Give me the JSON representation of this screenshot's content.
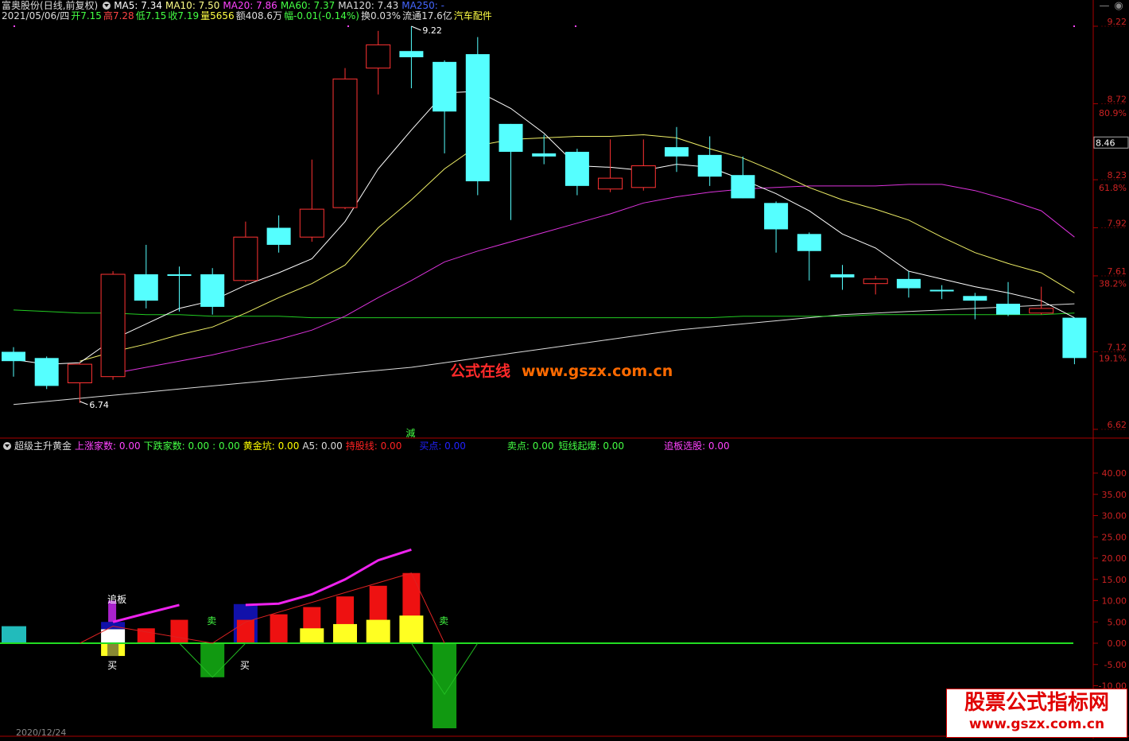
{
  "header": {
    "stock_name": "富奥股份",
    "period": "(日线,前复权)",
    "ma": [
      {
        "label": "MA5: 7.34",
        "color": "#ffffff"
      },
      {
        "label": "MA10: 7.50",
        "color": "#ffff88"
      },
      {
        "label": "MA20: 7.86",
        "color": "#ff44ff"
      },
      {
        "label": "MA60: 7.37",
        "color": "#44ff44"
      },
      {
        "label": "MA120: 7.43",
        "color": "#dddddd"
      },
      {
        "label": "MA250: -",
        "color": "#4466ff"
      }
    ]
  },
  "quote": {
    "date": "2021/05/06/四",
    "open": "开7.15",
    "high": "高7.28",
    "low": "低7.15",
    "close": "收7.19",
    "volume": "量5656",
    "amount": "额408.6万",
    "change": "幅-0.01(-0.14%)",
    "turnover": "换0.03%",
    "float": "流通17.6亿",
    "industry": "汽车配件"
  },
  "price_axis": {
    "ticks": [
      {
        "label": "9.22",
        "value": 9.22
      },
      {
        "label": "8.72",
        "value": 8.72
      },
      {
        "label": "8.23",
        "value": 8.23
      },
      {
        "label": "7.92",
        "value": 7.92
      },
      {
        "label": "7.61",
        "value": 7.61
      },
      {
        "label": "7.12",
        "value": 7.12
      },
      {
        "label": "6.62",
        "value": 6.62
      }
    ],
    "pct_ticks": [
      {
        "label": "80.9%",
        "value": 8.66
      },
      {
        "label": "61.8%",
        "value": 8.18
      },
      {
        "label": "38.2%",
        "value": 7.56
      },
      {
        "label": "19.1%",
        "value": 7.08
      }
    ],
    "current": "8.46",
    "max_label": "9.22",
    "min_label": "6.74"
  },
  "mark_text": "減",
  "indicator": {
    "name": "超级主升黄金",
    "fields": [
      {
        "label": "上涨家数: 0.00",
        "color": "#ff44ff"
      },
      {
        "label": "下跌家数: 0.00",
        "color": "#44ff44"
      },
      {
        "label": ": 0.00",
        "color": "#44ff44"
      },
      {
        "label": "黄金坑: 0.00",
        "color": "#ffff00"
      },
      {
        "label": "A5: 0.00",
        "color": "#dddddd"
      },
      {
        "label": "持股线: 0.00",
        "color": "#ff2222"
      },
      {
        "label": "买点: 0.00",
        "color": "#2222ff"
      },
      {
        "label": "卖点: 0.00",
        "color": "#44ff44"
      },
      {
        "label": "短线起爆: 0.00",
        "color": "#44ff44"
      },
      {
        "label": "追板选股: 0.00",
        "color": "#ff44ff"
      }
    ],
    "ticks": [
      {
        "label": "40.00",
        "value": 40
      },
      {
        "label": "35.00",
        "value": 35
      },
      {
        "label": "30.00",
        "value": 30
      },
      {
        "label": "25.00",
        "value": 25
      },
      {
        "label": "20.00",
        "value": 20
      },
      {
        "label": "15.00",
        "value": 15
      },
      {
        "label": "10.00",
        "value": 10
      },
      {
        "label": "5.00",
        "value": 5
      },
      {
        "label": "0.00",
        "value": 0
      },
      {
        "label": "-5.00",
        "value": -5
      },
      {
        "label": "-10.00",
        "value": -10
      }
    ],
    "labels": [
      {
        "text": "追板",
        "i": 3,
        "v": 9.5,
        "color": "#ffffff"
      },
      {
        "text": "卖",
        "i": 6,
        "v": 4.5,
        "color": "#44ff44"
      },
      {
        "text": "卖",
        "i": 13,
        "v": 4.5,
        "color": "#44ff44"
      },
      {
        "text": "买",
        "i": 3,
        "v": -6,
        "color": "#ffffff"
      },
      {
        "text": "买",
        "i": 7,
        "v": -6,
        "color": "#ffffff"
      }
    ]
  },
  "watermark": {
    "cn": "公式在线",
    "url": "www.gszx.com.cn"
  },
  "logo": {
    "line1": "股票公式指标网",
    "line2": "www.gszx.com.cn"
  },
  "bottom_date": "2020/12/24",
  "chart_data": {
    "type": "candlestick",
    "candles": [
      {
        "o": 7.12,
        "c": 7.06,
        "h": 7.15,
        "l": 6.96
      },
      {
        "o": 7.08,
        "c": 6.9,
        "h": 7.09,
        "l": 6.88
      },
      {
        "o": 6.92,
        "c": 7.04,
        "h": 7.05,
        "l": 6.79
      },
      {
        "o": 6.96,
        "c": 7.62,
        "h": 7.64,
        "l": 6.94
      },
      {
        "o": 7.62,
        "c": 7.45,
        "h": 7.81,
        "l": 7.4
      },
      {
        "o": 7.62,
        "c": 7.61,
        "h": 7.67,
        "l": 7.38
      },
      {
        "o": 7.62,
        "c": 7.41,
        "h": 7.66,
        "l": 7.36
      },
      {
        "o": 7.58,
        "c": 7.86,
        "h": 7.96,
        "l": 7.57
      },
      {
        "o": 7.92,
        "c": 7.81,
        "h": 8.0,
        "l": 7.76
      },
      {
        "o": 7.86,
        "c": 8.04,
        "h": 8.36,
        "l": 7.83
      },
      {
        "o": 8.05,
        "c": 8.88,
        "h": 8.95,
        "l": 8.04
      },
      {
        "o": 8.95,
        "c": 9.1,
        "h": 9.19,
        "l": 8.78
      },
      {
        "o": 9.06,
        "c": 9.02,
        "h": 9.22,
        "l": 8.82
      },
      {
        "o": 8.99,
        "c": 8.67,
        "h": 9.0,
        "l": 8.4
      },
      {
        "o": 9.04,
        "c": 8.22,
        "h": 9.15,
        "l": 8.13
      },
      {
        "o": 8.59,
        "c": 8.41,
        "h": 8.59,
        "l": 7.97
      },
      {
        "o": 8.4,
        "c": 8.38,
        "h": 8.52,
        "l": 8.33
      },
      {
        "o": 8.41,
        "c": 8.19,
        "h": 8.43,
        "l": 8.13
      },
      {
        "o": 8.17,
        "c": 8.24,
        "h": 8.49,
        "l": 8.15
      },
      {
        "o": 8.18,
        "c": 8.32,
        "h": 8.49,
        "l": 8.16
      },
      {
        "o": 8.44,
        "c": 8.38,
        "h": 8.57,
        "l": 8.28
      },
      {
        "o": 8.39,
        "c": 8.25,
        "h": 8.51,
        "l": 8.19
      },
      {
        "o": 8.26,
        "c": 8.11,
        "h": 8.38,
        "l": 8.11
      },
      {
        "o": 8.08,
        "c": 7.91,
        "h": 8.09,
        "l": 7.76
      },
      {
        "o": 7.88,
        "c": 7.77,
        "h": 7.89,
        "l": 7.58
      },
      {
        "o": 7.62,
        "c": 7.6,
        "h": 7.68,
        "l": 7.52
      },
      {
        "o": 7.56,
        "c": 7.59,
        "h": 7.61,
        "l": 7.49
      },
      {
        "o": 7.59,
        "c": 7.53,
        "h": 7.64,
        "l": 7.47
      },
      {
        "o": 7.52,
        "c": 7.51,
        "h": 7.55,
        "l": 7.46
      },
      {
        "o": 7.48,
        "c": 7.45,
        "h": 7.5,
        "l": 7.33
      },
      {
        "o": 7.43,
        "c": 7.36,
        "h": 7.57,
        "l": 7.35
      },
      {
        "o": 7.37,
        "c": 7.4,
        "h": 7.54,
        "l": 7.36
      },
      {
        "o": 7.34,
        "c": 7.08,
        "h": 7.34,
        "l": 7.04
      }
    ],
    "ma5": [
      7.07,
      7.04,
      7.05,
      7.2,
      7.3,
      7.4,
      7.45,
      7.55,
      7.63,
      7.72,
      7.96,
      8.3,
      8.55,
      8.79,
      8.8,
      8.69,
      8.53,
      8.32,
      8.31,
      8.29,
      8.33,
      8.31,
      8.23,
      8.14,
      8.03,
      7.88,
      7.79,
      7.64,
      7.59,
      7.54,
      7.5,
      7.45,
      7.34
    ],
    "ma10": [
      null,
      null,
      7.06,
      7.12,
      7.17,
      7.23,
      7.28,
      7.37,
      7.47,
      7.56,
      7.68,
      7.92,
      8.1,
      8.3,
      8.45,
      8.49,
      8.5,
      8.51,
      8.51,
      8.52,
      8.5,
      8.43,
      8.37,
      8.28,
      8.18,
      8.1,
      8.04,
      7.97,
      7.86,
      7.76,
      7.69,
      7.63,
      7.5
    ],
    "ma20": [
      null,
      null,
      null,
      6.98,
      7.02,
      7.06,
      7.1,
      7.15,
      7.2,
      7.26,
      7.35,
      7.47,
      7.58,
      7.7,
      7.77,
      7.83,
      7.89,
      7.95,
      8.01,
      8.08,
      8.12,
      8.15,
      8.17,
      8.18,
      8.19,
      8.19,
      8.19,
      8.2,
      8.2,
      8.16,
      8.1,
      8.03,
      7.86
    ],
    "ma60": [
      7.39,
      7.38,
      7.37,
      7.37,
      7.36,
      7.36,
      7.35,
      7.35,
      7.35,
      7.34,
      7.34,
      7.34,
      7.34,
      7.34,
      7.34,
      7.34,
      7.34,
      7.34,
      7.34,
      7.34,
      7.34,
      7.34,
      7.35,
      7.35,
      7.35,
      7.35,
      7.36,
      7.36,
      7.36,
      7.36,
      7.36,
      7.36,
      7.37
    ],
    "ma120": [
      6.78,
      6.8,
      6.82,
      6.84,
      6.86,
      6.88,
      6.9,
      6.92,
      6.94,
      6.96,
      6.98,
      7.0,
      7.02,
      7.05,
      7.08,
      7.11,
      7.14,
      7.17,
      7.2,
      7.23,
      7.26,
      7.28,
      7.3,
      7.32,
      7.34,
      7.36,
      7.37,
      7.38,
      7.39,
      7.4,
      7.41,
      7.42,
      7.43
    ],
    "ind_red": [
      0,
      0,
      0,
      0,
      3.5,
      5.5,
      0,
      5.5,
      6.8,
      8.5,
      11,
      13.5,
      16.5,
      0,
      0,
      0,
      0,
      0,
      0,
      0,
      0,
      0,
      0,
      0,
      0,
      0,
      0,
      0,
      0,
      0,
      0,
      0,
      0
    ],
    "ind_yellow": [
      0,
      0,
      0,
      3.3,
      0,
      0,
      0,
      0,
      0,
      3.5,
      4.5,
      5.5,
      6.5,
      0,
      0,
      0,
      0,
      0,
      0,
      0,
      0,
      0,
      0,
      0,
      0,
      0,
      0,
      0,
      0,
      0,
      0,
      0,
      0
    ],
    "ind_yellow_neg": [
      0,
      0,
      0,
      -3,
      0,
      0,
      0,
      0,
      0,
      0,
      0,
      0,
      0,
      0,
      0,
      0,
      0,
      0,
      0,
      0,
      0,
      0,
      0,
      0,
      0,
      0,
      0,
      0,
      0,
      0,
      0,
      0,
      0
    ],
    "ind_green": [
      0,
      0,
      0,
      0,
      0,
      0,
      -8,
      0,
      0,
      0,
      0,
      0,
      0,
      -20,
      0,
      0,
      0,
      0,
      0,
      0,
      0,
      0,
      0,
      0,
      0,
      0,
      0,
      0,
      0,
      0,
      0,
      0,
      0
    ],
    "ind_magenta_line": [
      null,
      null,
      null,
      5,
      7,
      9,
      null,
      9,
      9.3,
      11.5,
      15,
      19.5,
      22,
      null,
      null,
      null,
      null,
      null,
      null,
      null,
      null,
      null,
      null,
      null,
      null,
      null,
      null,
      null,
      null,
      null,
      null,
      null,
      null
    ],
    "ind_red_line": [
      null,
      null,
      0,
      4,
      null,
      null,
      0,
      5,
      null,
      null,
      null,
      null,
      16.5,
      0,
      null,
      null,
      null,
      null,
      null,
      null,
      null,
      null,
      null,
      null,
      null,
      null,
      null,
      null,
      null,
      null,
      null,
      null,
      null
    ],
    "ind_green_line": [
      null,
      null,
      null,
      null,
      null,
      0,
      -8,
      0,
      null,
      null,
      null,
      null,
      0,
      -12,
      0,
      null,
      null,
      null,
      null,
      null,
      null,
      null,
      null,
      null,
      null,
      null,
      null,
      null,
      null,
      null,
      null,
      null,
      null
    ]
  }
}
